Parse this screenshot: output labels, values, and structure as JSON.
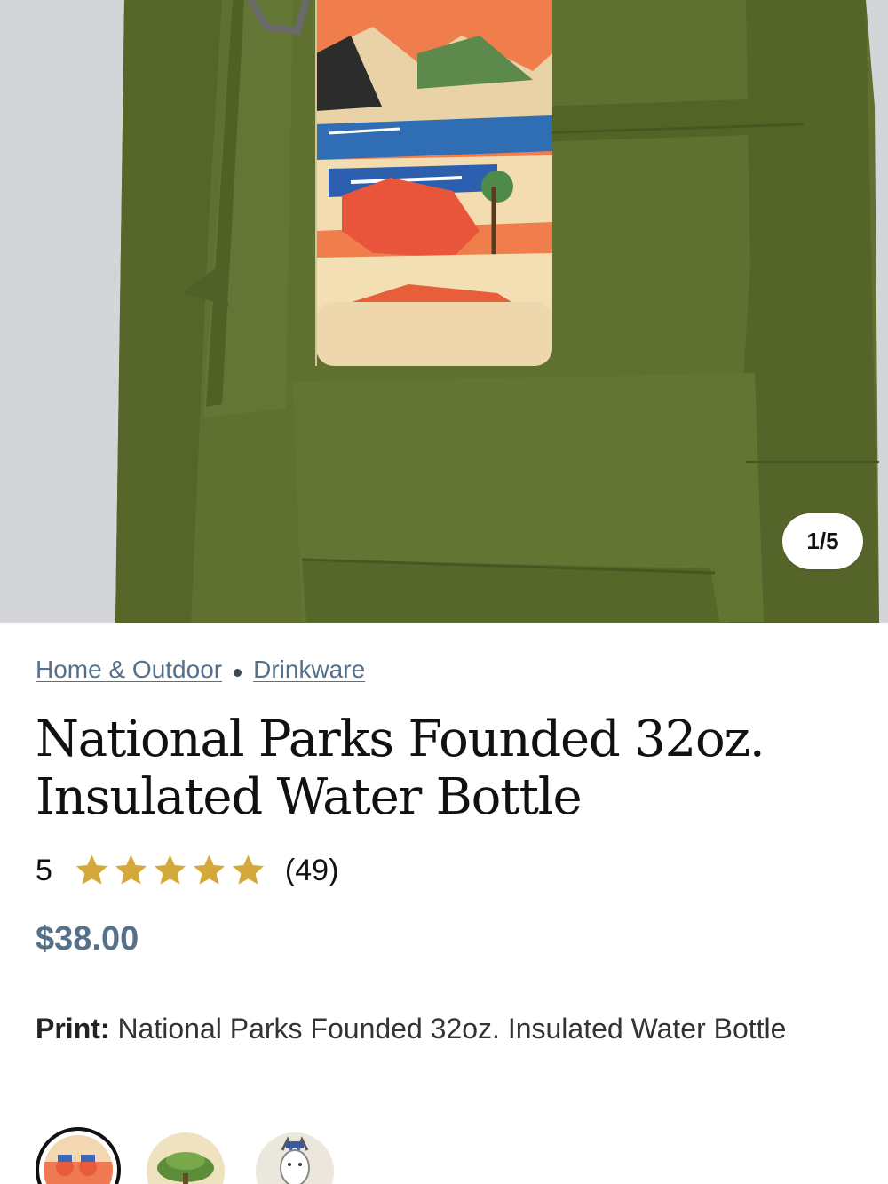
{
  "gallery": {
    "counter": "1/5",
    "image_alt": "Insulated water bottle with national parks print hanging from olive green pants"
  },
  "breadcrumb": {
    "items": [
      "Home & Outdoor",
      "Drinkware"
    ]
  },
  "product": {
    "title_line1": "National Parks Founded 32oz.",
    "title_line2": "Insulated Water Bottle",
    "rating_value": "5",
    "rating_stars": 5,
    "rating_count": "(49)",
    "price": "$38.00"
  },
  "options": {
    "print_label": "Print:",
    "print_value": "National Parks Founded 32oz. Insulated Water Bottle",
    "swatches": [
      {
        "name": "National Parks Founded",
        "selected": true
      },
      {
        "name": "Tree print",
        "selected": false
      },
      {
        "name": "Goat print",
        "selected": false
      }
    ]
  },
  "colors": {
    "accent_link": "#56708a",
    "star": "#d4a93c",
    "pants": "#5e6f2c"
  }
}
